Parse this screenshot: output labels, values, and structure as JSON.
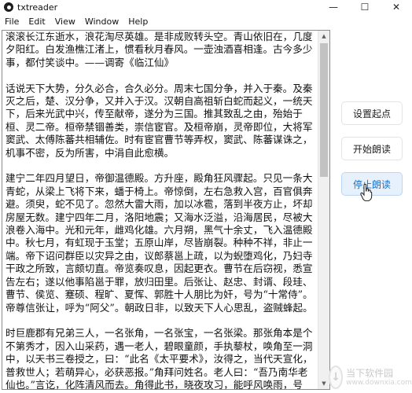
{
  "window": {
    "title": "txtreader",
    "controls": [
      "—",
      "☐",
      "✕"
    ]
  },
  "menu": {
    "items": [
      "File",
      "Edit",
      "View",
      "Window",
      "Help"
    ]
  },
  "editor": {
    "paragraphs": [
      "滚滚长江东逝水，浪花淘尽英雄。是非成败转头空。青山依旧在，几度夕阳红。白发渔樵江渚上，惯看秋月春风。一壶浊酒喜相逢。古今多少事，都付笑谈中。——调寄《临江仙》",
      "话说天下大势，分久必合，合久必分。周末七国分争，并入于秦。及秦灭之后，楚、汉分争，又并入于汉。汉朝自高祖斩白蛇而起义，一统天下，后来光武中兴，传至献帝，遂分为三国。推其致乱之由，殆始于桓、灵二帝。桓帝禁锢善类，崇信宦官。及桓帝崩，灵帝即位，大将军窦武、太傅陈蕃共相辅佐。时有宦官曹节等弄权，窦武、陈蕃谋诛之，机事不密，反为所害，中涓自此愈横。",
      "建宁二年四月望日，帝御温德殿。方升座，殿角狂风骤起。只见一条大青蛇，从梁上飞将下来，蟠于椅上。帝惊倒，左右急救入宫，百官俱奔避。须臾，蛇不见了。忽然大雷大雨，加以冰雹，落到半夜方止，坏却房屋无数。建宁四年二月，洛阳地震；又海水泛溢，沿海居民，尽被大浪卷入海中。光和元年，雌鸡化雄。六月朔，黑气十余丈，飞入温德殿中。秋七月，有虹现于玉堂；五原山岸，尽皆崩裂。种种不祥，非止一端。帝下诏问群臣以灾异之由，议郎蔡邕上疏，以为蜺堕鸡化，乃妇寺干政之所致，言颇切直。帝览奏叹息，因起更衣。曹节在后窃视，悉宣告左右；遂以他事陷邕于罪，放归田里。后张让、赵忠、封谞、段珪、曹节、侯览、蹇硕、程旷、夏恽、郭胜十人朋比为奸，号为“十常侍”。帝尊信张让，呼为“阿父”。朝政日非，以致天下人心思乱，盗贼蜂起。",
      "时巨鹿郡有兄弟三人，一名张角，一名张宝，一名张梁。那张角本是个不第秀才，因入山采药，遇一老人，碧眼童颜，手执藜杖，唤角至一洞中，以天书三卷授之，曰：“此名《太平要术》，汝得之，当代天宣化，普救世人；若萌异心，必获恶报。”角拜问姓名。老人曰：“吾乃南华老仙也。”言讫，化阵清风而去。角得此书，晓夜攻习，能呼风唤雨，号为“太平道人”。"
    ]
  },
  "buttons": {
    "set_start": "设置起点",
    "start_read": "开始朗读",
    "stop_read": "停止朗读"
  },
  "watermark": {
    "line1": "当下软件园",
    "line2": "www.downxia.com"
  },
  "icons": [
    "app-icon",
    "scroll-up-arrow-icon",
    "scroll-down-arrow-icon",
    "hand-cursor-icon",
    "watermark-logo-icon"
  ],
  "colors": {
    "active_button_bg": "#e6f1fb",
    "active_button_text": "#1a6fc4"
  }
}
